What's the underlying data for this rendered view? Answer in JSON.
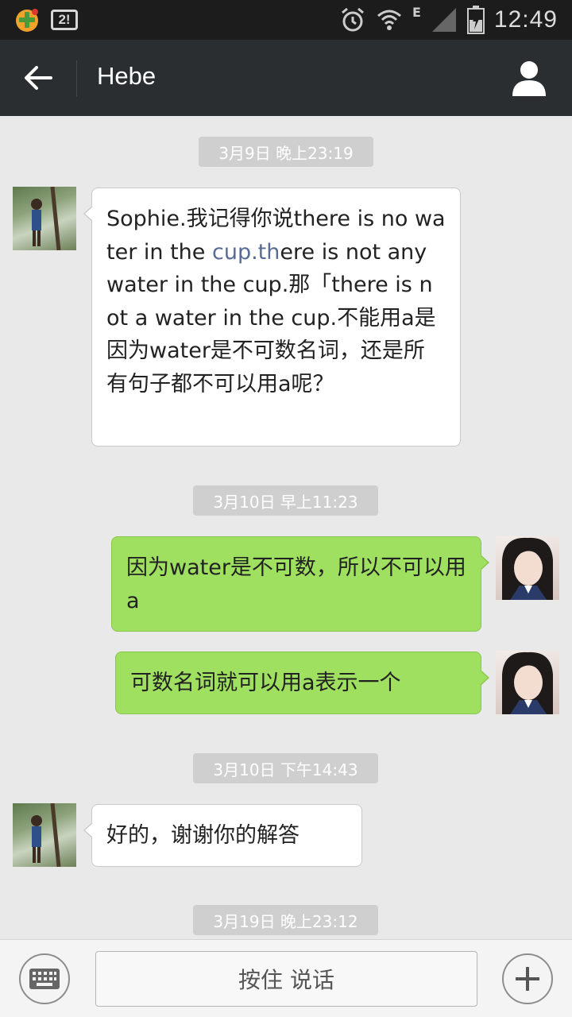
{
  "status_bar": {
    "network": "E",
    "time": "12:49",
    "badge": "2!"
  },
  "header": {
    "title": "Hebe"
  },
  "timestamps": [
    "3月9日 晚上23:19",
    "3月10日 早上11:23",
    "3月10日 下午14:43",
    "3月19日 晚上23:12"
  ],
  "messages": [
    {
      "sender": "friend",
      "text_before": "Sophie.我记得你说there is no water in the ",
      "link": "cup.th",
      "text_after": "ere is not any water in the cup.那「there is not a water in the cup.不能用a是因为water是不可数名词，还是所有句子都不可以用a呢？"
    },
    {
      "sender": "me",
      "text": "因为water是不可数，所以不可以用a"
    },
    {
      "sender": "me",
      "text": "可数名词就可以用a表示一个"
    },
    {
      "sender": "friend",
      "text": "好的，谢谢你的解答"
    }
  ],
  "input_bar": {
    "hold_to_talk": "按住 说话"
  },
  "colors": {
    "title_bar": "#2b2e31",
    "status_bar": "#1c1c1c",
    "chat_bg": "#e9e9e9",
    "outgoing_bubble": "#9fe060",
    "incoming_bubble": "#ffffff",
    "link": "#576b95"
  }
}
